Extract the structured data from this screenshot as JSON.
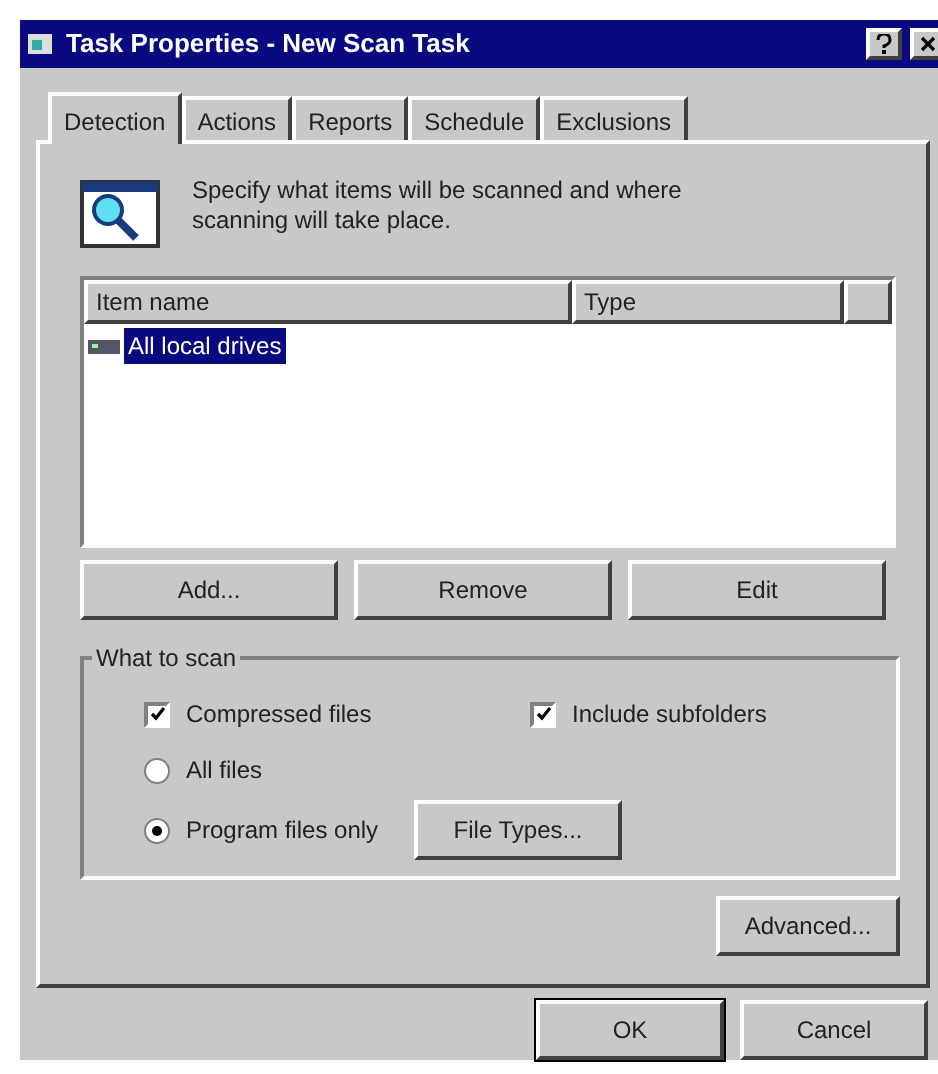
{
  "window": {
    "title": "Task Properties - New Scan Task"
  },
  "tabs": [
    {
      "label": "Detection",
      "selected": true
    },
    {
      "label": "Actions",
      "selected": false
    },
    {
      "label": "Reports",
      "selected": false
    },
    {
      "label": "Schedule",
      "selected": false
    },
    {
      "label": "Exclusions",
      "selected": false
    }
  ],
  "description": "Specify what items will be scanned and where scanning will take place.",
  "list": {
    "columns": [
      "Item name",
      "Type"
    ],
    "rows": [
      {
        "name": "All local drives",
        "selected": true
      }
    ]
  },
  "list_buttons": [
    "Add...",
    "Remove",
    "Edit"
  ],
  "what_to_scan": {
    "label": "What to scan",
    "options": [
      {
        "kind": "checkbox",
        "label": "Compressed files",
        "checked": true
      },
      {
        "kind": "checkbox",
        "label": "Include subfolders",
        "checked": true
      },
      {
        "kind": "radio",
        "label": "All files",
        "selected": false
      },
      {
        "kind": "radio",
        "label": "Program files only",
        "selected": true
      }
    ],
    "file_types_button": "File Types..."
  },
  "advanced_button": "Advanced...",
  "dialog_buttons": [
    "OK",
    "Cancel"
  ]
}
